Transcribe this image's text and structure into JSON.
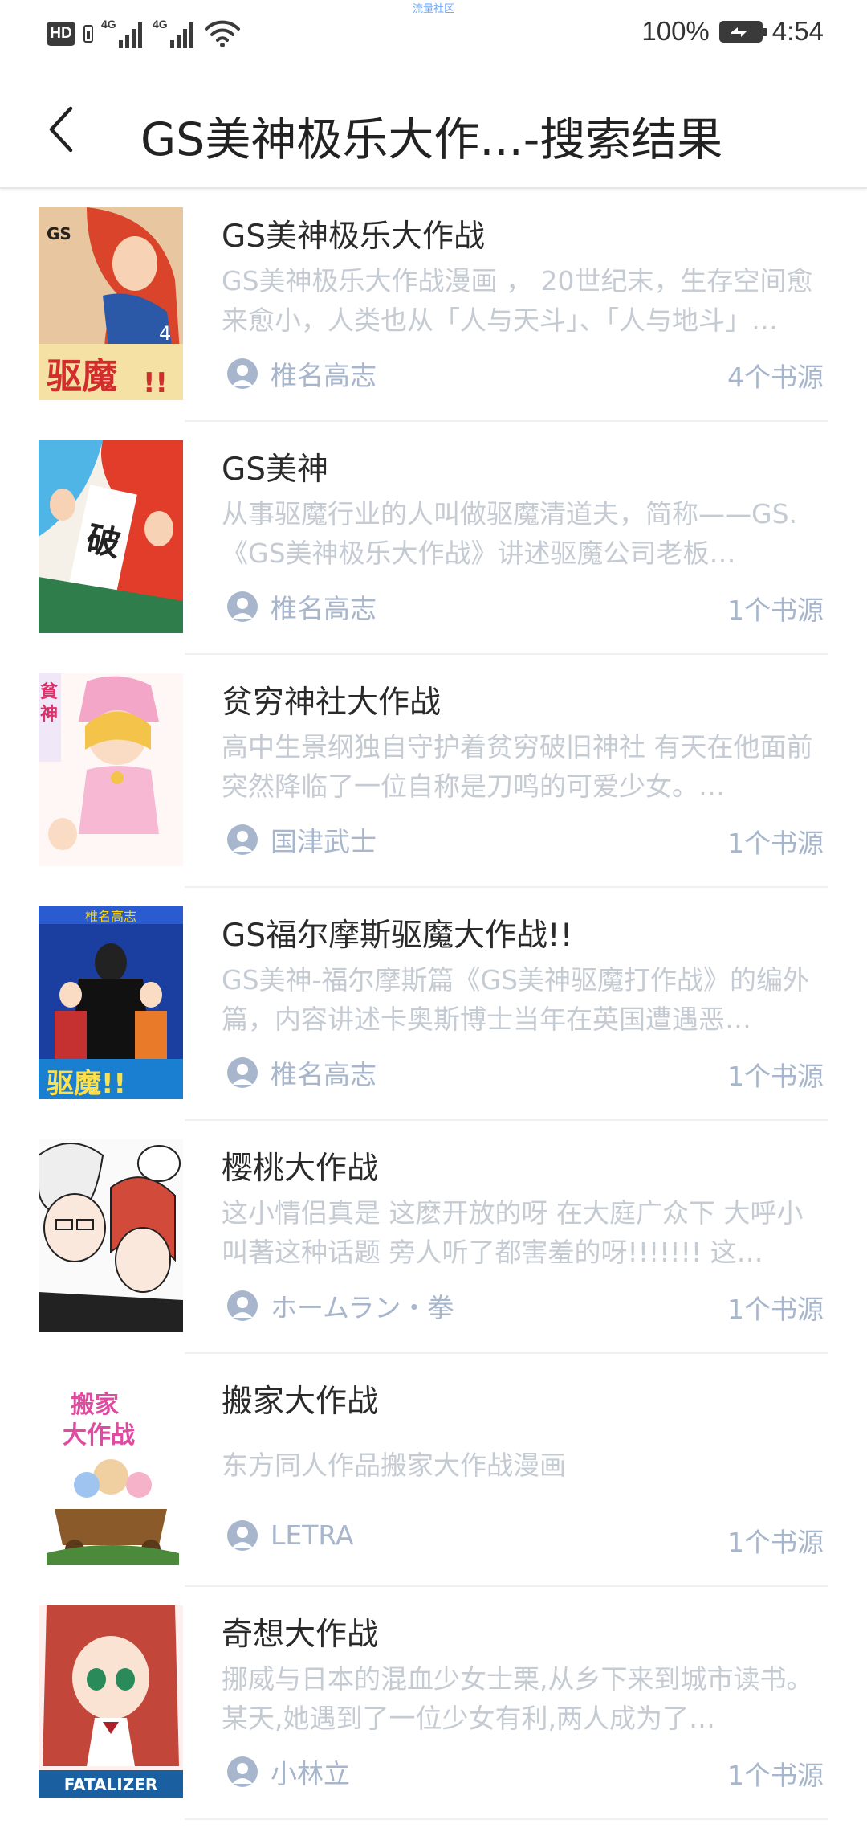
{
  "status_bar": {
    "hd": "HD",
    "network1": "4G",
    "network2": "4G",
    "center_note": "流量社区",
    "battery_percent": "100%",
    "time": "4:54"
  },
  "header": {
    "title": "GS美神极乐大作...-搜索结果",
    "back_icon": "chevron-left-icon"
  },
  "results": [
    {
      "title": "GS美神极乐大作战",
      "description": "GS美神极乐大作战漫画 ， 20世纪末，生存空间愈来愈小，人类也从「人与天斗」、「人与地斗」…",
      "author": "椎名高志",
      "sources": "4个书源"
    },
    {
      "title": "GS美神",
      "description": "从事驱魔行业的人叫做驱魔清道夫，简称——GS.《GS美神极乐大作战》讲述驱魔公司老板…",
      "author": "椎名高志",
      "sources": "1个书源"
    },
    {
      "title": "贫穷神社大作战",
      "description": "高中生景纲独自守护着贫穷破旧神社 有天在他面前突然降临了一位自称是刀鸣的可爱少女。…",
      "author": "国津武士",
      "sources": "1个书源"
    },
    {
      "title": "GS福尔摩斯驱魔大作战!!",
      "description": "GS美神-福尔摩斯篇《GS美神驱魔打作战》的编外篇，内容讲述卡奥斯博士当年在英国遭遇恶…",
      "author": "椎名高志",
      "sources": "1个书源"
    },
    {
      "title": "樱桃大作战",
      "description": "这小情侣真是 这麽开放的呀 在大庭广众下 大呼小叫著这种话题 旁人听了都害羞的呀!!!!!!! 这…",
      "author": "ホームラン・拳",
      "sources": "1个书源"
    },
    {
      "title": "搬家大作战",
      "description": "东方同人作品搬家大作战漫画",
      "author": "LETRA",
      "sources": "1个书源"
    },
    {
      "title": "奇想大作战",
      "description": "挪威与日本的混血少女士栗,从乡下来到城市读书。某天,她遇到了一位少女有利,两人成为了…",
      "author": "小林立",
      "sources": "1个书源"
    }
  ]
}
